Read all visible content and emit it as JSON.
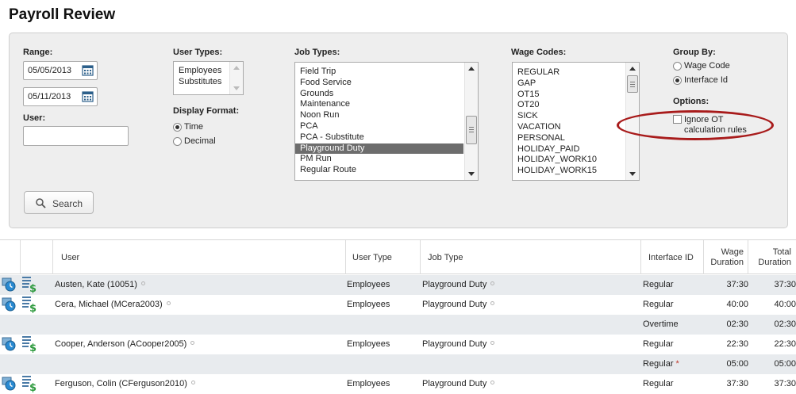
{
  "page": {
    "title": "Payroll Review"
  },
  "filters": {
    "range_label": "Range:",
    "start_date": "05/05/2013",
    "end_date": "05/11/2013",
    "user_label": "User:",
    "user_value": "",
    "user_types_label": "User Types:",
    "user_types": [
      "Employees",
      "Substitutes"
    ],
    "display_format_label": "Display Format:",
    "display_formats": [
      {
        "label": "Time",
        "checked": true
      },
      {
        "label": "Decimal",
        "checked": false
      }
    ],
    "job_types_label": "Job Types:",
    "job_types": [
      "Field Trip",
      "Food Service",
      "Grounds",
      "Maintenance",
      "Noon Run",
      "PCA",
      "PCA - Substitute",
      "Playground Duty",
      "PM Run",
      "Regular Route"
    ],
    "job_types_selected": "Playground Duty",
    "wage_codes_label": "Wage Codes:",
    "wage_codes": [
      "REGULAR",
      "GAP",
      "OT15",
      "OT20",
      "SICK",
      "VACATION",
      "PERSONAL",
      "HOLIDAY_PAID",
      "HOLIDAY_WORK10",
      "HOLIDAY_WORK15"
    ],
    "group_by_label": "Group By:",
    "group_by": [
      {
        "label": "Wage Code",
        "checked": false
      },
      {
        "label": "Interface Id",
        "checked": true
      }
    ],
    "options_label": "Options:",
    "ignore_ot_line1": "Ignore OT",
    "ignore_ot_line2": "calculation rules",
    "ignore_ot_checked": false,
    "search_label": "Search"
  },
  "table": {
    "headers": {
      "user": "User",
      "user_type": "User Type",
      "job_type": "Job Type",
      "interface_id": "Interface ID",
      "wage_duration_1": "Wage",
      "wage_duration_2": "Duration",
      "total_duration_1": "Total",
      "total_duration_2": "Duration"
    },
    "rows": [
      {
        "icons": true,
        "user": "Austen, Kate (10051)",
        "user_type": "Employees",
        "job_type": "Playground Duty",
        "interface_id": "Regular",
        "required": false,
        "wage_duration": "37:30",
        "total_duration": "37:30"
      },
      {
        "icons": true,
        "user": "Cera, Michael (MCera2003)",
        "user_type": "Employees",
        "job_type": "Playground Duty",
        "interface_id": "Regular",
        "required": false,
        "wage_duration": "40:00",
        "total_duration": "40:00"
      },
      {
        "icons": false,
        "user": "",
        "user_type": "",
        "job_type": "",
        "interface_id": "Overtime",
        "required": false,
        "wage_duration": "02:30",
        "total_duration": "02:30"
      },
      {
        "icons": true,
        "user": "Cooper, Anderson (ACooper2005)",
        "user_type": "Employees",
        "job_type": "Playground Duty",
        "interface_id": "Regular",
        "required": false,
        "wage_duration": "22:30",
        "total_duration": "22:30"
      },
      {
        "icons": false,
        "user": "",
        "user_type": "",
        "job_type": "",
        "interface_id": "Regular",
        "required": true,
        "wage_duration": "05:00",
        "total_duration": "05:00"
      },
      {
        "icons": true,
        "user": "Ferguson, Colin (CFerguson2010)",
        "user_type": "Employees",
        "job_type": "Playground Duty",
        "interface_id": "Regular",
        "required": false,
        "wage_duration": "37:30",
        "total_duration": "37:30"
      }
    ]
  },
  "colors": {
    "highlight": "#a81b1b",
    "selected_item": "#6d6d6d",
    "row_alt": "#e8ebee",
    "panel": "#eeeeee"
  },
  "icons": {
    "calendar": "calendar-icon",
    "search": "search-icon",
    "timecard": "timecard-clock-icon",
    "payroll": "payroll-dollar-icon",
    "info": "info-dot-icon"
  }
}
